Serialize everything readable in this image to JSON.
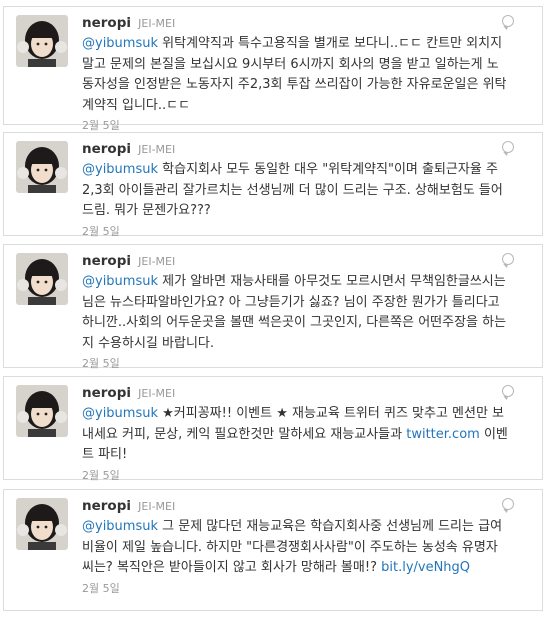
{
  "tweets": [
    {
      "screen_name": "neropi",
      "full_name": "JEI-MEI",
      "mention": "@yibumsuk",
      "text": " 위탁계약직과 특수고용직을 별개로 보다니..ㄷㄷ 칸트만 외치지 말고 문제의 본질을 보십시요 9시부터 6시까지 회사의 명을 받고 일하는게 노동자성을 인정받은 노동자지 주2,3회 투잡 쓰리잡이 가능한 자유로운일은 위탁계약직 입니다..ㄷㄷ",
      "time": "2월 5일"
    },
    {
      "screen_name": "neropi",
      "full_name": "JEI-MEI",
      "mention": "@yibumsuk",
      "text": " 학습지회사 모두 동일한 대우 \"위탁계약직\"이며 출퇴근자율 주 2,3회 아이들관리 잘가르치는 선생님께 더 많이 드리는 구조. 상해보험도 들어드림. 뭐가 문젠가요???",
      "time": "2월 5일"
    },
    {
      "screen_name": "neropi",
      "full_name": "JEI-MEI",
      "mention": "@yibumsuk",
      "text": " 제가 알바면 재능사태를 아무것도 모르시면서 무책임한글쓰시는 님은 뉴스타파알바인가요? 아 그냥듣기가 싫죠? 님이 주장한 뭔가가 틀리다고 하니깐..사회의 어두운곳을 볼땐 썩은곳이 그곳인지, 다른쪽은 어떤주장을 하는지 수용하시길 바랍니다.",
      "time": "2월 5일"
    },
    {
      "screen_name": "neropi",
      "full_name": "JEI-MEI",
      "mention": "@yibumsuk",
      "text": " ★커피꽁짜!! 이벤트 ★ 재능교육 트위터 퀴즈 맞추고 멘션만 보내세요 커피, 문상, 케익 필요한것만 말하세요 재능교사들과 ",
      "link": "twitter.com",
      "text_after": " 이벤트 파티!",
      "time": "2월 5일"
    },
    {
      "screen_name": "neropi",
      "full_name": "JEI-MEI",
      "mention": "@yibumsuk",
      "text": " 그 문제 많다던 재능교육은 학습지회사중 선생님께 드리는 급여비율이 제일 높습니다. 하지만 \"다른경쟁회사사람\"이 주도하는 농성속 유명자씨는? 복직안은 받아들이지 않고 회사가 망해라 볼매!? ",
      "link": "bit.ly/veNhgQ",
      "text_after": "",
      "time": "2월 5일"
    }
  ],
  "colors": {
    "link": "#2276bb",
    "meta": "#999999",
    "text": "#333333"
  },
  "icons": {
    "reply": "reply-bubble-icon"
  }
}
